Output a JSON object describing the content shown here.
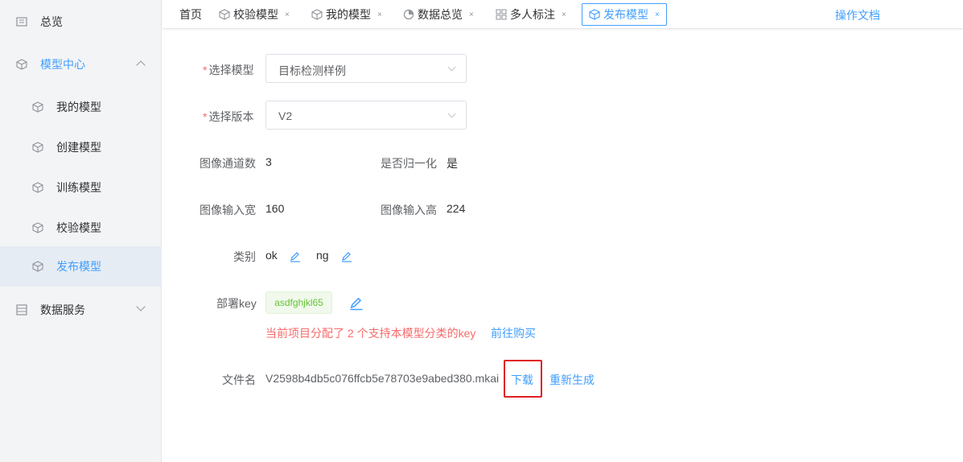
{
  "sidebar": {
    "items": [
      {
        "label": "总览",
        "icon": "overview-icon"
      },
      {
        "label": "模型中心",
        "icon": "cube-icon"
      },
      {
        "label": "我的模型",
        "icon": "cube-icon"
      },
      {
        "label": "创建模型",
        "icon": "cube-icon"
      },
      {
        "label": "训练模型",
        "icon": "cube-icon"
      },
      {
        "label": "校验模型",
        "icon": "cube-icon"
      },
      {
        "label": "发布模型",
        "icon": "cube-icon"
      },
      {
        "label": "数据服务",
        "icon": "database-icon"
      }
    ]
  },
  "tabs": [
    {
      "label": "首页"
    },
    {
      "label": "校验模型",
      "close": "×"
    },
    {
      "label": "我的模型",
      "close": "×"
    },
    {
      "label": "数据总览",
      "close": "×"
    },
    {
      "label": "多人标注",
      "close": "×"
    },
    {
      "label": "发布模型",
      "close": "×"
    }
  ],
  "header": {
    "docs_link": "操作文档"
  },
  "form": {
    "required_mark": "*",
    "select_model_label": "选择模型",
    "select_model_value": "目标检测样例",
    "select_version_label": "选择版本",
    "select_version_value": "V2",
    "channels_label": "图像通道数",
    "channels_value": "3",
    "normalize_label": "是否归一化",
    "normalize_value": "是",
    "width_label": "图像输入宽",
    "width_value": "160",
    "height_label": "图像输入高",
    "height_value": "224",
    "category_label": "类别",
    "categories": [
      "ok",
      "ng"
    ],
    "deploy_key_label": "部署key",
    "deploy_key_value": "asdfghjkl65",
    "key_warning": "当前项目分配了 2 个支持本模型分类的key",
    "buy_link": "前往购买",
    "file_label": "文件名",
    "file_value": "V2598b4db5c076ffcb5e78703e9abed380.mkai",
    "download_label": "下载",
    "regenerate_label": "重新生成"
  },
  "colors": {
    "accent": "#409eff",
    "danger": "#f56c6c",
    "success": "#67c23a",
    "highlight_box": "#e02020"
  }
}
